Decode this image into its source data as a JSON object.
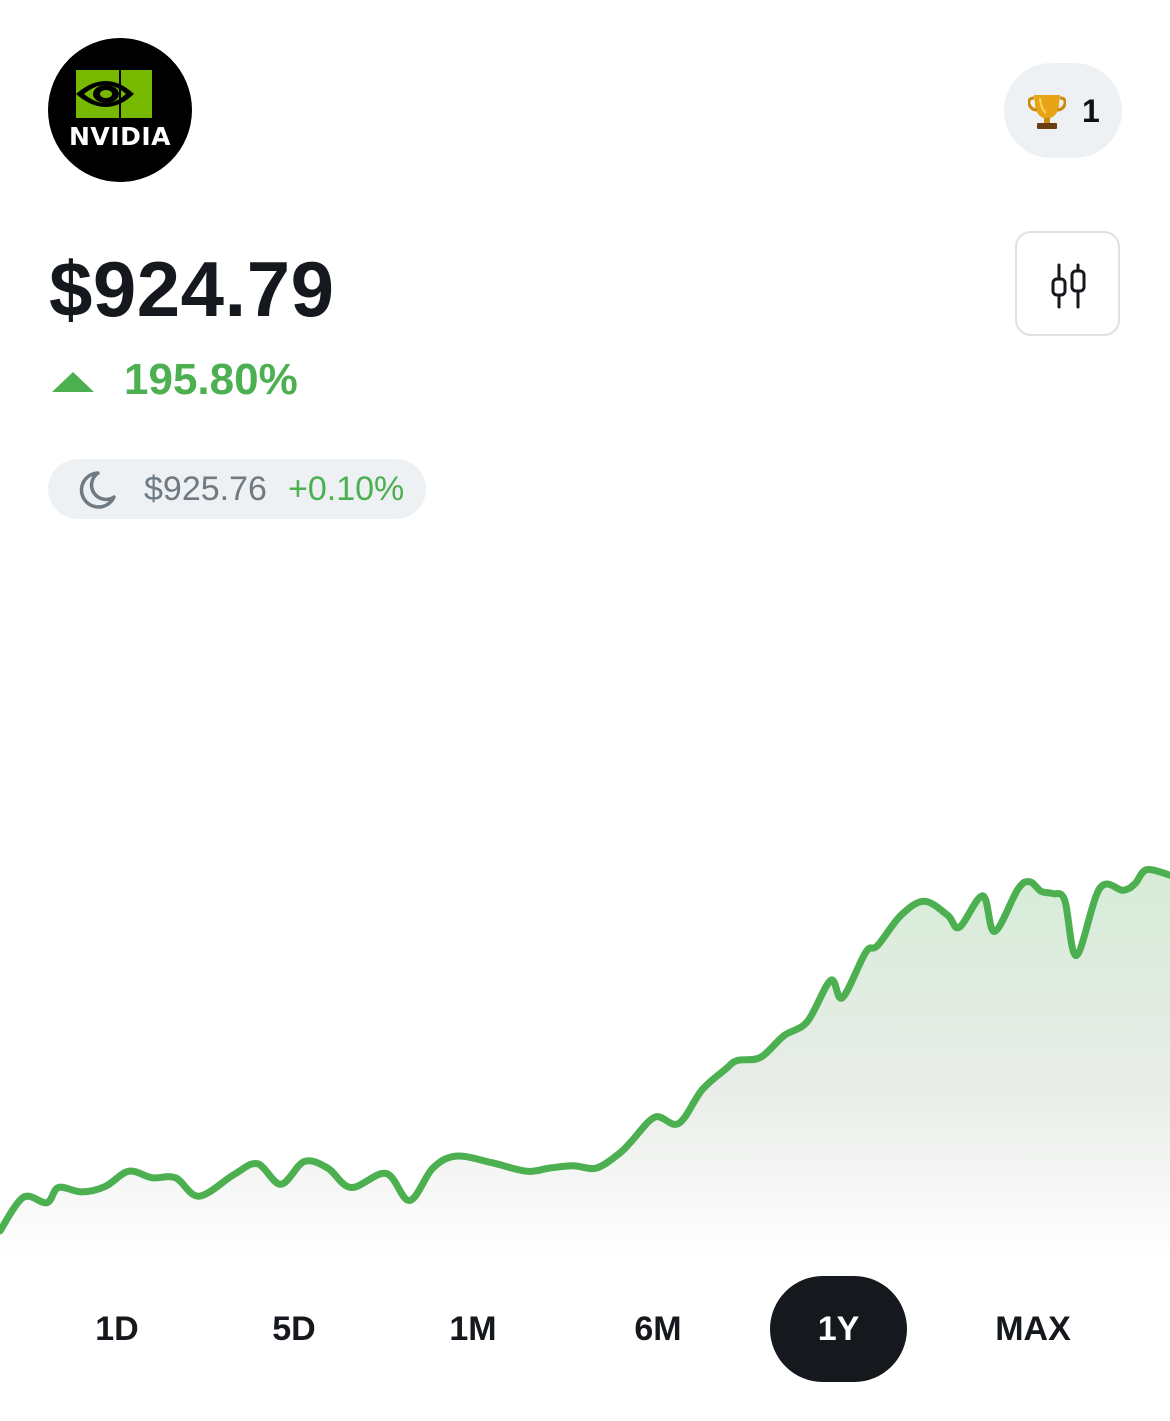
{
  "stock": {
    "logo_text": "NVIDIA",
    "price": "$924.79",
    "change_percent": "195.80%",
    "change_direction": "up",
    "after_hours": {
      "icon": "moon-icon",
      "price": "$925.76",
      "change": "+0.10%"
    }
  },
  "header": {
    "trophy_icon": "trophy-icon",
    "trophy_count": "1",
    "chart_type_icon": "candlestick-icon"
  },
  "ranges": {
    "items": [
      {
        "label": "1D",
        "active": false
      },
      {
        "label": "5D",
        "active": false
      },
      {
        "label": "1M",
        "active": false
      },
      {
        "label": "6M",
        "active": false
      },
      {
        "label": "1Y",
        "active": true
      },
      {
        "label": "MAX",
        "active": false
      }
    ]
  },
  "colors": {
    "accent_green": "#4caf50",
    "text_dark": "#15191d",
    "muted": "#6f7a83",
    "pill_bg": "#eef1f3",
    "logo_green": "#76b900"
  },
  "chart_data": {
    "type": "area",
    "title": "",
    "xlabel": "",
    "ylabel": "",
    "ylim": [
      300,
      950
    ],
    "x_range": [
      0,
      100
    ],
    "series": [
      {
        "x": [
          0,
          2,
          4,
          5,
          7,
          9,
          11,
          13,
          15,
          17,
          20,
          22,
          24,
          26,
          28,
          30,
          33,
          35,
          37,
          39,
          42,
          45,
          47,
          49,
          51,
          53,
          54,
          56,
          58,
          60,
          62,
          63,
          65,
          67,
          69,
          71,
          72,
          74,
          75,
          77,
          79,
          81,
          82,
          84,
          85,
          87,
          88,
          89,
          90,
          91,
          92,
          94,
          96,
          97,
          98,
          100
        ],
        "values": [
          313,
          344,
          339,
          353,
          349,
          354,
          368,
          362,
          362,
          345,
          365,
          375,
          356,
          377,
          371,
          353,
          366,
          341,
          371,
          382,
          376,
          368,
          371,
          373,
          371,
          385,
          396,
          418,
          412,
          443,
          462,
          470,
          473,
          493,
          506,
          544,
          528,
          570,
          576,
          604,
          617,
          604,
          593,
          622,
          589,
          628,
          635,
          626,
          624,
          618,
          567,
          629,
          627,
          633,
          646,
          641
        ]
      }
    ]
  }
}
